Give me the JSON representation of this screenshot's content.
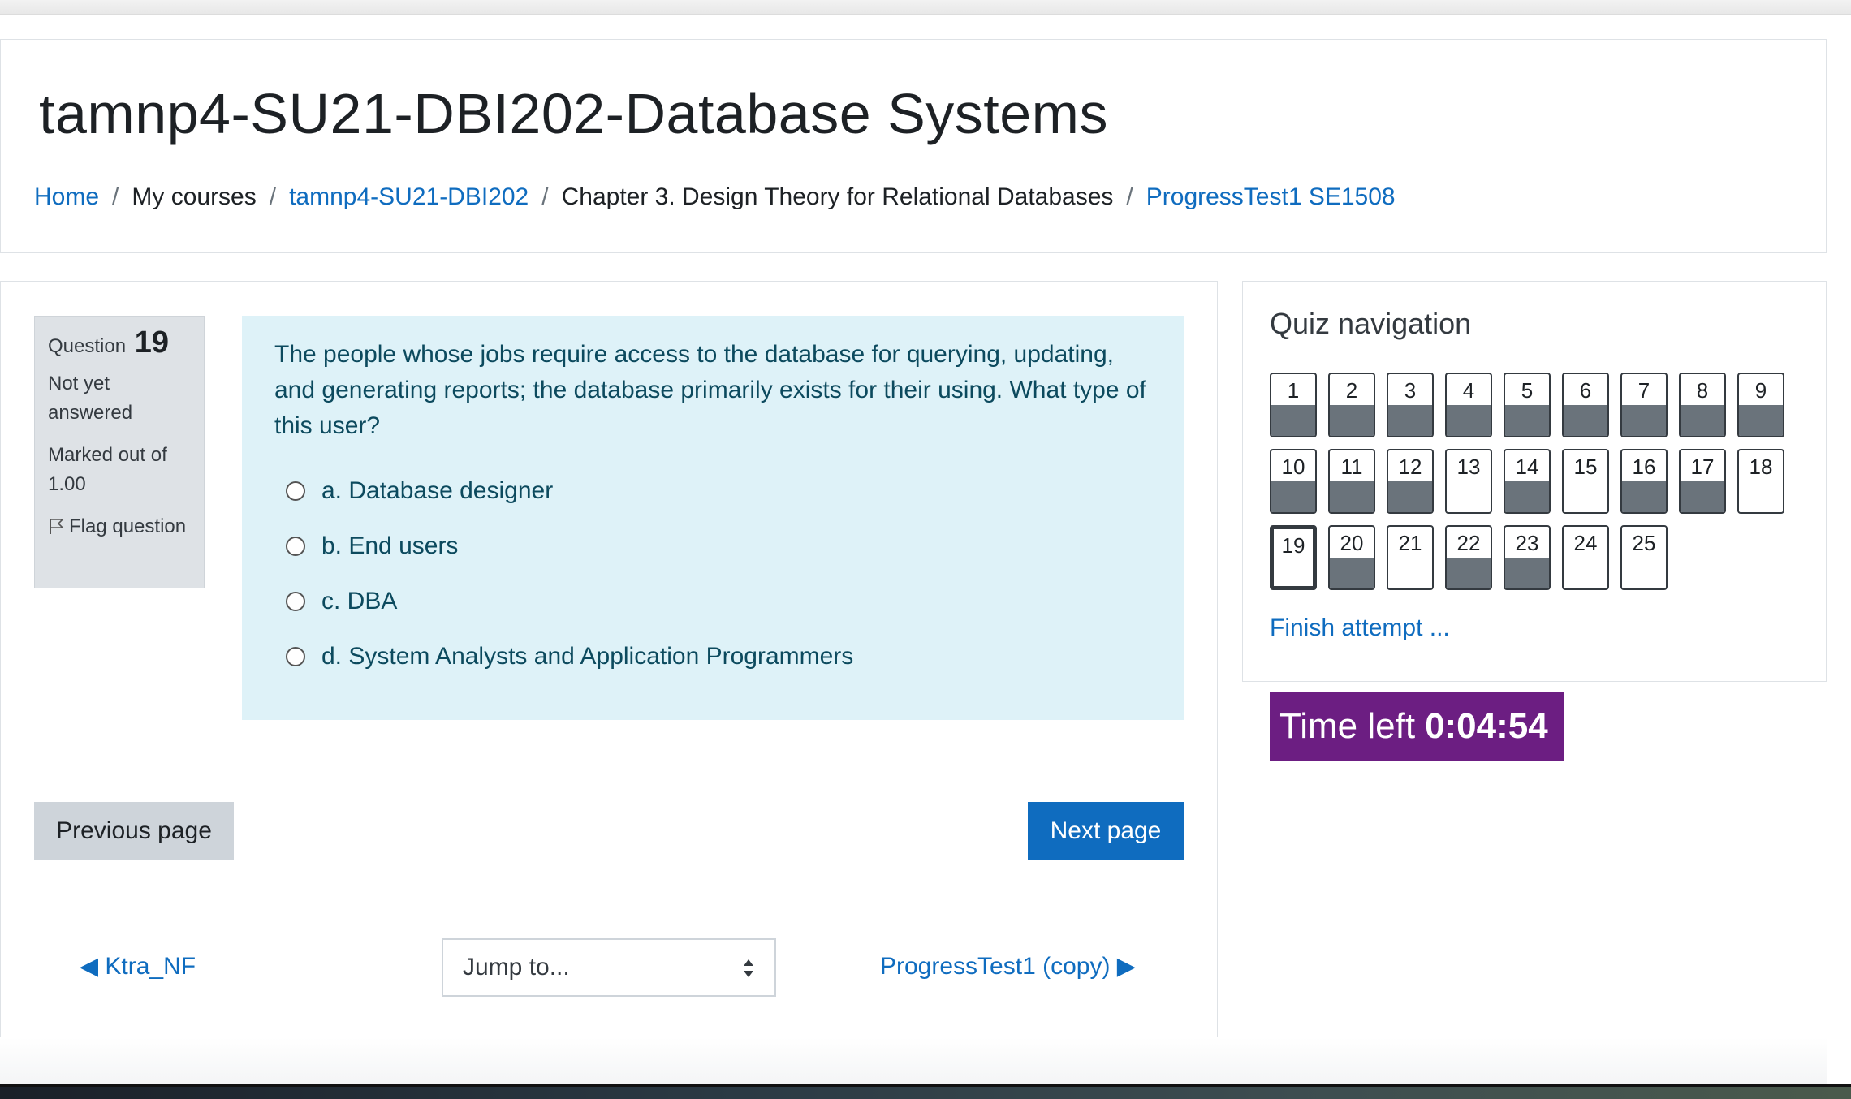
{
  "page": {
    "title": "tamnp4-SU21-DBI202-Database Systems"
  },
  "breadcrumb": {
    "items": [
      {
        "label": "Home",
        "link": true
      },
      {
        "label": "My courses",
        "link": false
      },
      {
        "label": "tamnp4-SU21-DBI202",
        "link": true
      },
      {
        "label": "Chapter 3. Design Theory for Relational Databases",
        "link": false
      },
      {
        "label": "ProgressTest1 SE1508",
        "link": true
      }
    ],
    "separator": "/"
  },
  "question_info": {
    "label": "Question",
    "number": "19",
    "state": "Not yet answered",
    "grade": "Marked out of 1.00",
    "flag_label": "Flag question"
  },
  "question": {
    "text": "The people whose jobs require access to the database for querying, updating, and generating reports; the database primarily exists for their using. What type of this user?",
    "answers": [
      "a. Database designer",
      "b. End users",
      "c. DBA",
      "d. System Analysts and Application Programmers"
    ]
  },
  "buttons": {
    "previous": "Previous page",
    "next": "Next page"
  },
  "activity_nav": {
    "prev": "◀ Ktra_NF",
    "jump_placeholder": "Jump to...",
    "next": "ProgressTest1 (copy) ▶"
  },
  "quiz_nav": {
    "title": "Quiz navigation",
    "questions": [
      {
        "n": "1",
        "answered": true
      },
      {
        "n": "2",
        "answered": true
      },
      {
        "n": "3",
        "answered": true
      },
      {
        "n": "4",
        "answered": true
      },
      {
        "n": "5",
        "answered": true
      },
      {
        "n": "6",
        "answered": true
      },
      {
        "n": "7",
        "answered": true
      },
      {
        "n": "8",
        "answered": true
      },
      {
        "n": "9",
        "answered": true
      },
      {
        "n": "10",
        "answered": true
      },
      {
        "n": "11",
        "answered": true
      },
      {
        "n": "12",
        "answered": true
      },
      {
        "n": "13",
        "answered": false
      },
      {
        "n": "14",
        "answered": true
      },
      {
        "n": "15",
        "answered": false
      },
      {
        "n": "16",
        "answered": true
      },
      {
        "n": "17",
        "answered": true
      },
      {
        "n": "18",
        "answered": false
      },
      {
        "n": "19",
        "answered": false,
        "current": true
      },
      {
        "n": "20",
        "answered": true
      },
      {
        "n": "21",
        "answered": false
      },
      {
        "n": "22",
        "answered": true
      },
      {
        "n": "23",
        "answered": true
      },
      {
        "n": "24",
        "answered": false
      },
      {
        "n": "25",
        "answered": false
      }
    ],
    "finish_label": "Finish attempt ..."
  },
  "timer": {
    "label": "Time left",
    "value": "0:04:54"
  },
  "colors": {
    "link": "#0f6cbf",
    "question_bg": "#def2f8",
    "timer_bg": "#6c1e82",
    "answered_fill": "#6a737b"
  }
}
